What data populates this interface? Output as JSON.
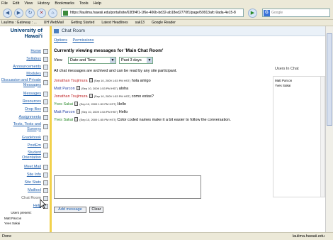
{
  "menubar": [
    "File",
    "Edit",
    "View",
    "History",
    "Bookmarks",
    "Tools",
    "Help"
  ],
  "nav_buttons": {
    "back": "◀",
    "forward": "▶",
    "reload": "↻",
    "stop": "✕",
    "home": "⌂"
  },
  "url": "https://laulima.hawaii.edu/portal/site/63f3f4f1-1f6e-406b-bd32-ab18ed2770f1/page/59913afc-9ada-4e15-8",
  "search_placeholder": "Google",
  "bookmarks": [
    "Laulima : Gateway : ...",
    "UH WebMail",
    "Getting Started",
    "Latest Headlines",
    "sak13",
    "Google Reader"
  ],
  "left_nav": {
    "site_title": "University of Hawai'i",
    "items": [
      "Home",
      "Syllabus",
      "Announcements",
      "Modules",
      "Discussion and Private Messages",
      "Messages",
      "Resources",
      "Drop Box",
      "Assignments",
      "Tests, Tests and Surveys",
      "Gradebook",
      "PostEm",
      "Student Orientation",
      "Meet.Mail",
      "Site Info",
      "Site Stats",
      "Mailtool",
      "Chat Room",
      "Help"
    ],
    "current": "Chat Room",
    "users_present_label": "Users present:",
    "users_present": [
      "Matt Parcon",
      "Yves Sakai"
    ]
  },
  "main": {
    "tool_title": "Chat Room",
    "tabs": [
      "Options",
      "Permissions"
    ],
    "currently_viewing": "Currently viewing messages for 'Main Chat Room'",
    "view_label": "View",
    "view_select": "Date and Time",
    "range_select": "Past 3 days",
    "archive_note": "All chat messages are archived and can be read by any site participant.",
    "messages": [
      {
        "author": "Jonathan Tsujimura",
        "color": "#c0282a",
        "timestamp": "(Sep 10, 2009 1:53 PM HST)",
        "text": "hola amigo"
      },
      {
        "author": "Matt Parcon",
        "color": "#2b47a8",
        "timestamp": "(Sep 10, 2009 1:53 PM HST)",
        "text": "aloha"
      },
      {
        "author": "Jonathan Tsujimura",
        "color": "#c0282a",
        "timestamp": "(Sep 10, 2009 1:53 PM HST)",
        "text": "como estas?"
      },
      {
        "author": "Yves Sakai",
        "color": "#2d8a2d",
        "timestamp": "(Sep 10, 2009 1:53 PM HST)",
        "text": "Hello"
      },
      {
        "author": "Matt Parcon",
        "color": "#2b47a8",
        "timestamp": "(Sep 10, 2009 1:54 PM HST)",
        "text": "Hello"
      },
      {
        "author": "Yves Sakai",
        "color": "#2d8a2d",
        "timestamp": "(Sep 10, 2009 1:55 PM HST)",
        "text": "Color coded names make it a bit easier to follow the conversation."
      }
    ],
    "users_in_chat_label": "Users In Chat",
    "users_in_chat": [
      "Matt Parcon",
      "Yves Sakai"
    ],
    "add_message_label": "Add message",
    "clear_label": "Clear"
  },
  "status": {
    "left": "Done",
    "right": "laulima.hawaii.edu"
  }
}
